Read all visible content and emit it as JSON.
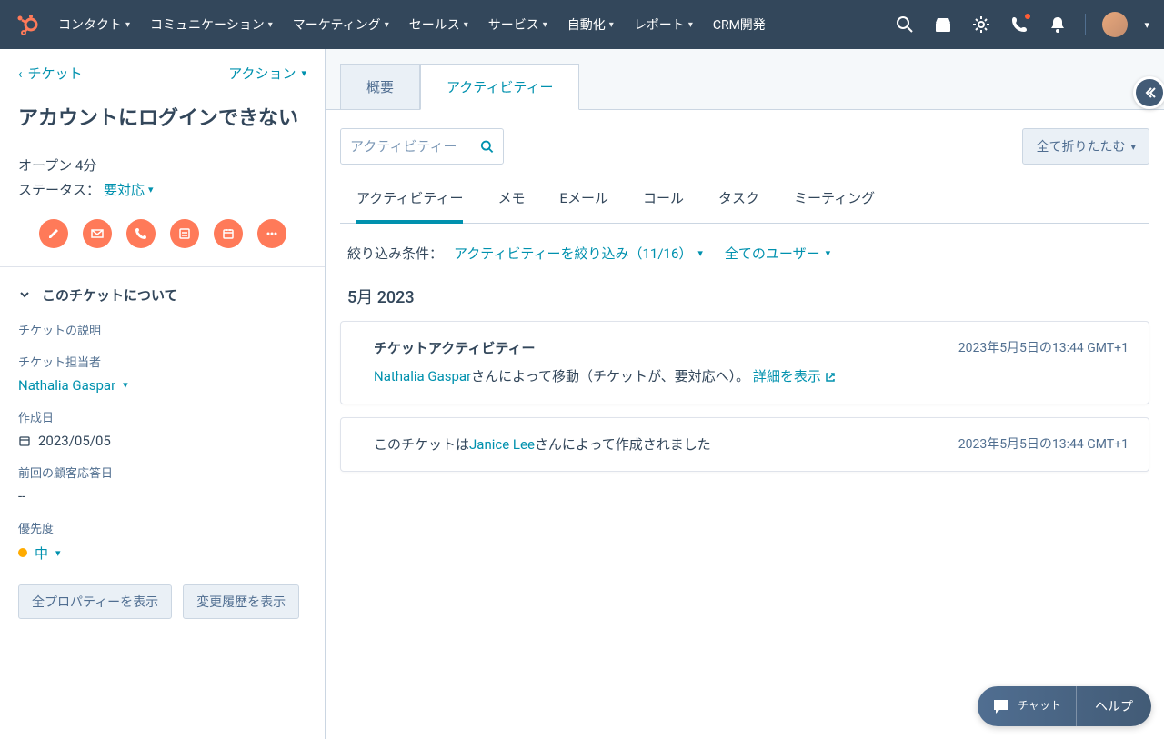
{
  "nav": {
    "items": [
      "コンタクト",
      "コミュニケーション",
      "マーケティング",
      "セールス",
      "サービス",
      "自動化",
      "レポート"
    ],
    "crm": "CRM開発"
  },
  "sidebar": {
    "back": "チケット",
    "action": "アクション",
    "title": "アカウントにログインできない",
    "open_line": "オープン 4分",
    "status_label": "ステータス：",
    "status_value": "要対応",
    "section": "このチケットについて",
    "props": {
      "desc_label": "チケットの説明",
      "owner_label": "チケット担当者",
      "owner_value": "Nathalia Gaspar",
      "created_label": "作成日",
      "created_value": "2023/05/05",
      "lastreply_label": "前回の顧客応答日",
      "lastreply_value": "--",
      "priority_label": "優先度",
      "priority_value": "中"
    },
    "btn_all_props": "全プロパティーを表示",
    "btn_history": "変更履歴を表示"
  },
  "tabs": {
    "overview": "概要",
    "activity": "アクティビティー"
  },
  "search_placeholder": "アクティビティー",
  "collapse_all": "全て折りたたむ",
  "sub_tabs": [
    "アクティビティー",
    "メモ",
    "Eメール",
    "コール",
    "タスク",
    "ミーティング"
  ],
  "filter": {
    "label": "絞り込み条件：",
    "activity": "アクティビティーを絞り込み（11/16）",
    "users": "全てのユーザー"
  },
  "month": "5月 2023",
  "card1": {
    "title": "チケットアクティビティー",
    "time": "2023年5月5日の13:44 GMT+1",
    "actor": "Nathalia Gaspar",
    "text1": "さんによって移動（チケットが、要対応へ）。",
    "details": "詳細を表示"
  },
  "card2": {
    "time": "2023年5月5日の13:44 GMT+1",
    "text1": "このチケットは",
    "actor": "Janice Lee",
    "text2": "さんによって作成されました"
  },
  "help": {
    "chat": "チャット",
    "help": "ヘルプ"
  }
}
